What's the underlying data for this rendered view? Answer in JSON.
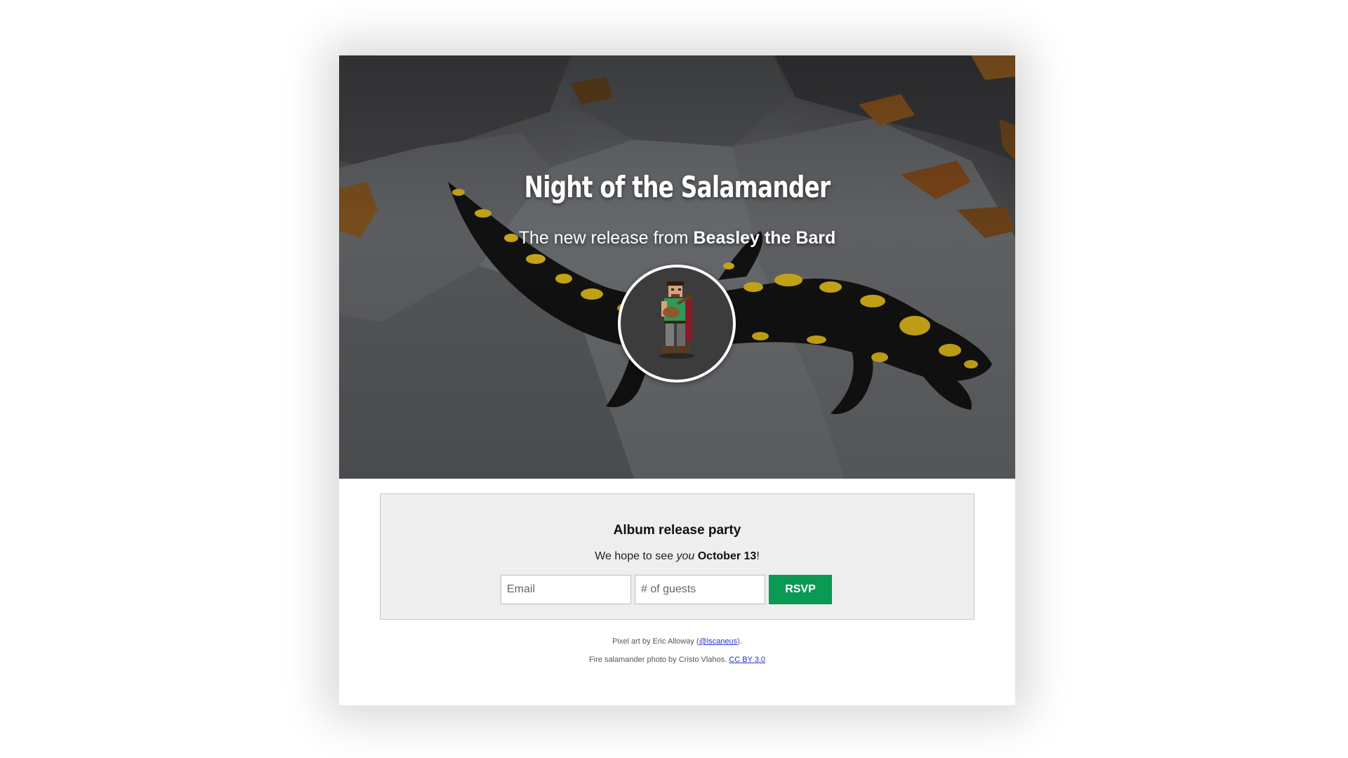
{
  "hero": {
    "title": "Night of the Salamander",
    "subtitle_prefix": "The new release from",
    "subtitle_artist": "Beasley the Bard",
    "avatar_icon": "bard-pixel-art-icon"
  },
  "party": {
    "heading": "Album release party",
    "text_prefix": "We hope to see",
    "text_emphasis": "you",
    "text_date": "October 13",
    "text_suffix": "!"
  },
  "form": {
    "email_placeholder": "Email",
    "guests_placeholder": "# of guests",
    "rsvp_label": "RSVP"
  },
  "credits": {
    "line1_prefix": "Pixel art by Eric Alloway (",
    "line1_link": "@lscaneus",
    "line1_suffix": ").",
    "line2_prefix": "Fire salamander photo by Cristo Vlahos.",
    "line2_link": "CC BY 3.0"
  },
  "colors": {
    "accent": "#0a9a53",
    "link": "#2233cc",
    "panel_bg": "#eeeeee",
    "salamander_yellow": "#e9c21a"
  }
}
